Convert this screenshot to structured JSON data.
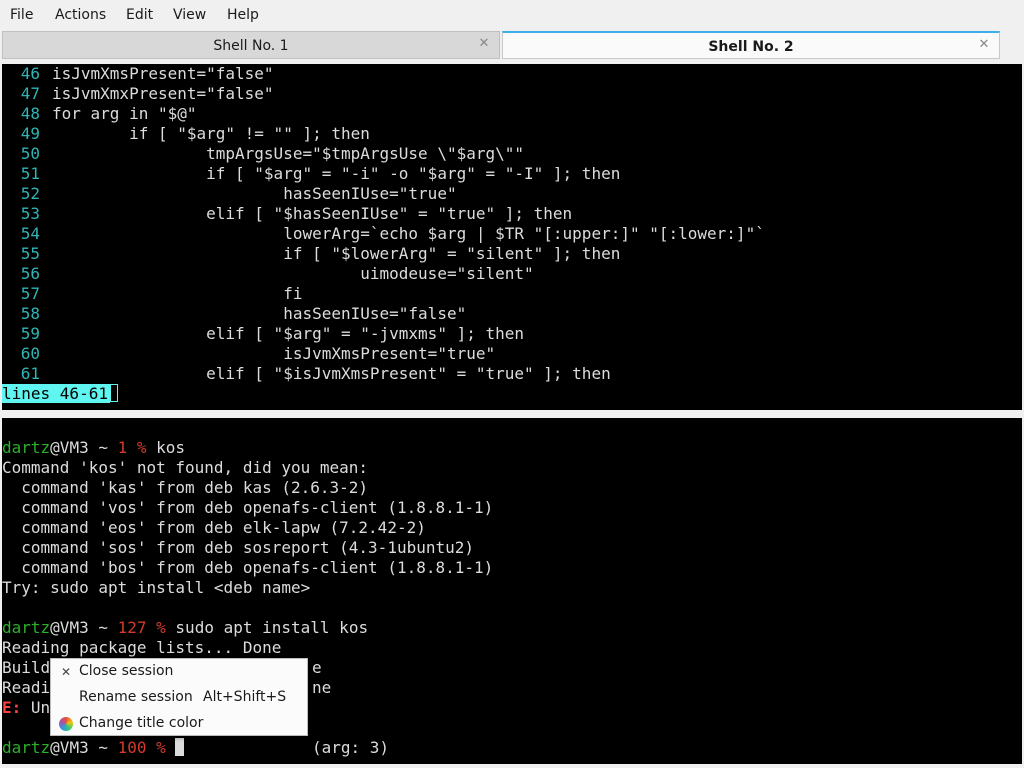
{
  "menubar": {
    "items": [
      "File",
      "Actions",
      "Edit",
      "View",
      "Help"
    ]
  },
  "tabs": [
    {
      "label": "Shell No. 1",
      "active": false
    },
    {
      "label": "Shell No. 2",
      "active": true
    }
  ],
  "pane_top": {
    "lines": [
      {
        "num": "46",
        "code": "isJvmXmsPresent=\"false\""
      },
      {
        "num": "47",
        "code": "isJvmXmxPresent=\"false\""
      },
      {
        "num": "48",
        "code": "for arg in \"$@\""
      },
      {
        "num": "49",
        "code": "        if [ \"$arg\" != \"\" ]; then"
      },
      {
        "num": "50",
        "code": "                tmpArgsUse=\"$tmpArgsUse \\\"$arg\\\"\""
      },
      {
        "num": "51",
        "code": "                if [ \"$arg\" = \"-i\" -o \"$arg\" = \"-I\" ]; then"
      },
      {
        "num": "52",
        "code": "                        hasSeenIUse=\"true\""
      },
      {
        "num": "53",
        "code": "                elif [ \"$hasSeenIUse\" = \"true\" ]; then"
      },
      {
        "num": "54",
        "code": "                        lowerArg=`echo $arg | $TR \"[:upper:]\" \"[:lower:]\"`"
      },
      {
        "num": "55",
        "code": "                        if [ \"$lowerArg\" = \"silent\" ]; then"
      },
      {
        "num": "56",
        "code": "                                uimodeuse=\"silent\""
      },
      {
        "num": "57",
        "code": "                        fi"
      },
      {
        "num": "58",
        "code": "                        hasSeenIUse=\"false\""
      },
      {
        "num": "59",
        "code": "                elif [ \"$arg\" = \"-jvmxms\" ]; then"
      },
      {
        "num": "60",
        "code": "                        isJvmXmsPresent=\"true\""
      },
      {
        "num": "61",
        "code": "                elif [ \"$isJvmXmsPresent\" = \"true\" ]; then"
      }
    ],
    "status": "lines 46-61"
  },
  "pane_bottom": {
    "prompt_user": "dartz",
    "prompt_host": "@VM3 ~ ",
    "prompt_end": " % ",
    "block1": {
      "code": "1",
      "command": "kos",
      "output": [
        "Command 'kos' not found, did you mean:",
        "  command 'kas' from deb kas (2.6.3-2)",
        "  command 'vos' from deb openafs-client (1.8.8.1-1)",
        "  command 'eos' from deb elk-lapw (7.2.42-2)",
        "  command 'sos' from deb sosreport (4.3-1ubuntu2)",
        "  command 'bos' from deb openafs-client (1.8.8.1-1)",
        "Try: sudo apt install <deb name>"
      ]
    },
    "block2": {
      "code": "127",
      "command": "sudo apt install kos",
      "output": [
        "Reading package lists... Done",
        "Build",
        "Readi"
      ],
      "output_tail": [
        "e",
        "ne"
      ],
      "error_prefix": "E:",
      "error_text": " Un"
    },
    "block3": {
      "code": "100",
      "arg_hint": "(arg: 3)"
    }
  },
  "context_menu": {
    "items": [
      {
        "icon": "close-icon",
        "label": "Close session",
        "shortcut": ""
      },
      {
        "icon": "",
        "label": "Rename session",
        "shortcut": "Alt+Shift+S"
      },
      {
        "icon": "color-wheel-icon",
        "label": "Change title color",
        "shortcut": ""
      }
    ]
  }
}
